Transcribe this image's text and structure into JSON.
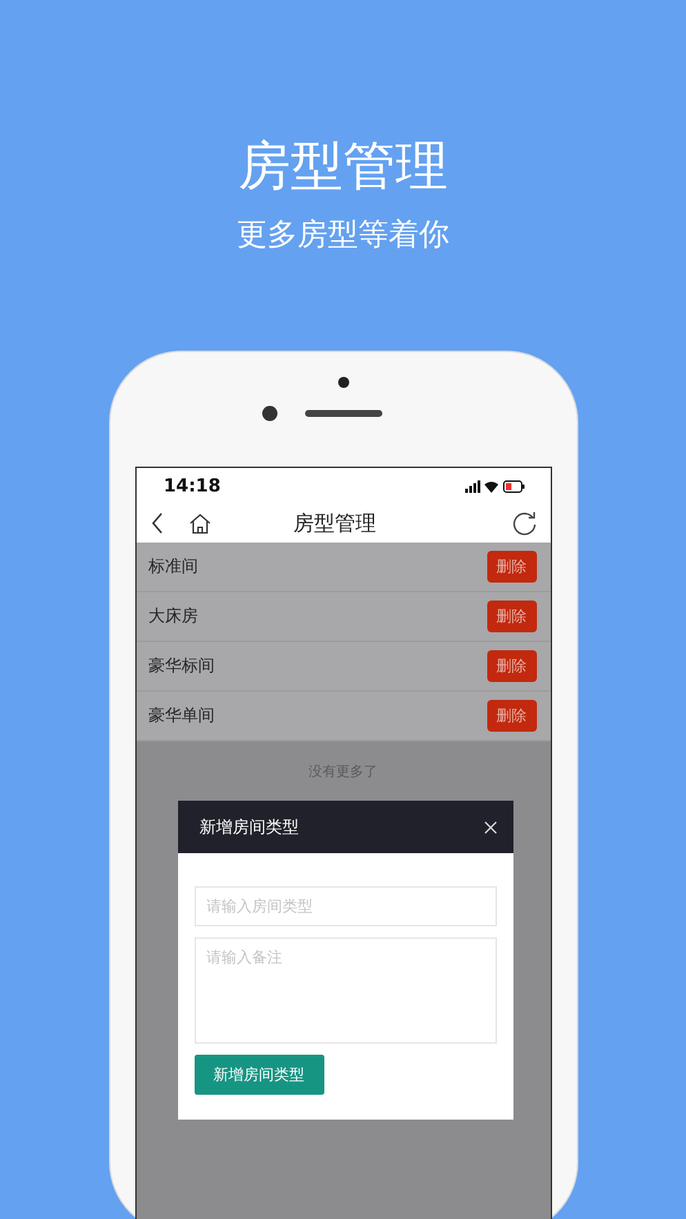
{
  "headline": "房型管理",
  "subtitle": "更多房型等着你",
  "status_bar": {
    "time": "14:18"
  },
  "nav": {
    "title": "房型管理"
  },
  "rooms": [
    {
      "name": "标准间",
      "action": "删除"
    },
    {
      "name": "大床房",
      "action": "删除"
    },
    {
      "name": "豪华标间",
      "action": "删除"
    },
    {
      "name": "豪华单间",
      "action": "删除"
    }
  ],
  "list_footer": "没有更多了",
  "dialog": {
    "title": "新增房间类型",
    "type_field": {
      "placeholder": "请输入房间类型"
    },
    "note_field": {
      "placeholder": "请输入备注"
    },
    "submit": "新增房间类型"
  }
}
